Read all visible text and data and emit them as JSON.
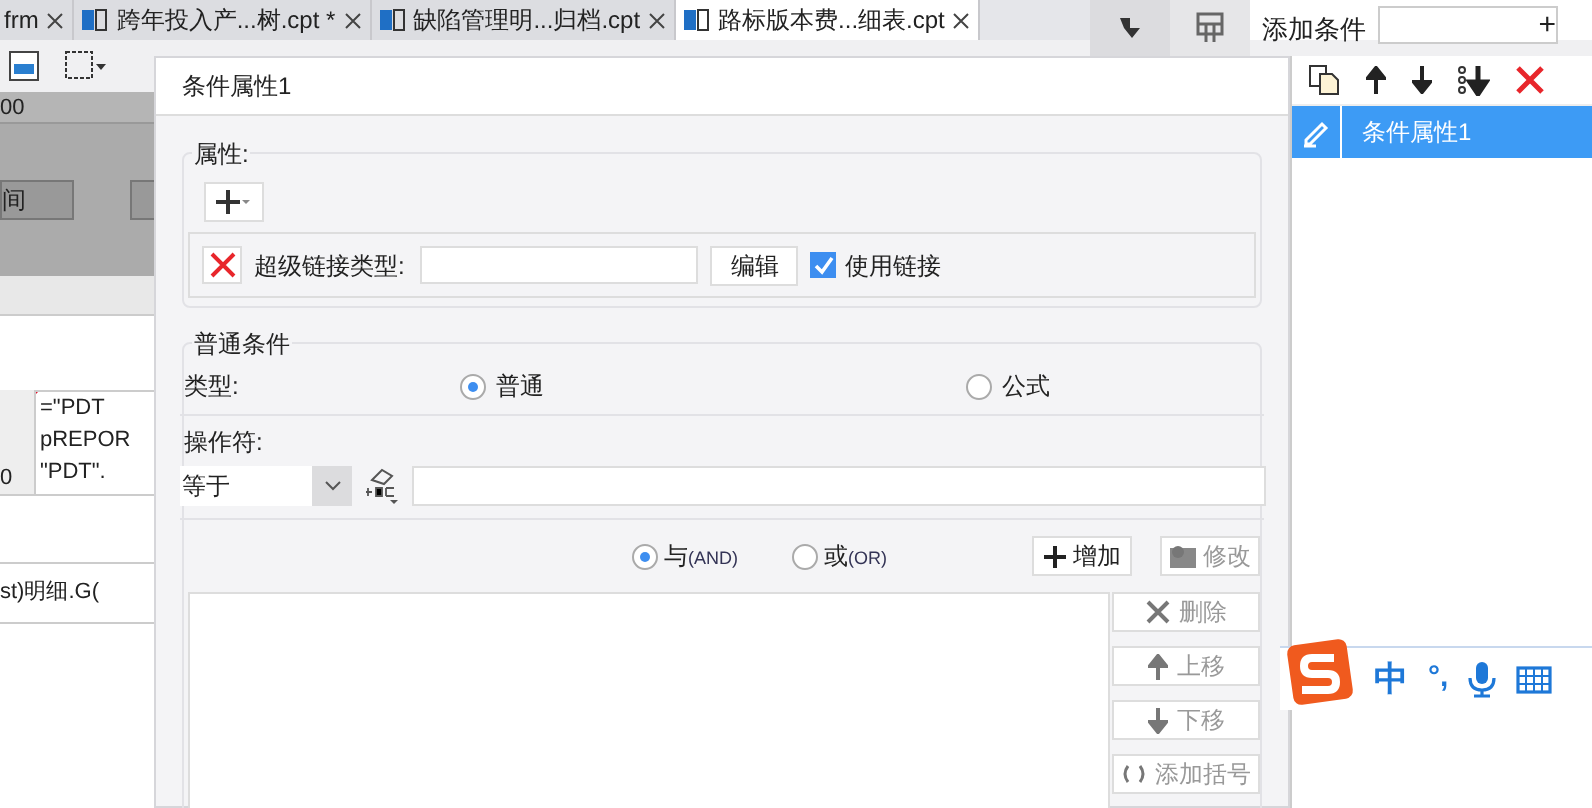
{
  "tabs": [
    {
      "label": "frm",
      "selected": false
    },
    {
      "label": "跨年投入产...树.cpt *",
      "selected": false
    },
    {
      "label": "缺陷管理明...归档.cpt",
      "selected": false
    },
    {
      "label": "路标版本费...细表.cpt",
      "selected": true
    }
  ],
  "sheet": {
    "ruler": "00",
    "button": "间",
    "formula_lines": [
      "=\"PDT",
      "pREPOR",
      "\"PDT\"."
    ],
    "left_cell": "0",
    "bottom_cell": "st)明细.G("
  },
  "dialog": {
    "title": "条件属性1",
    "attributes": {
      "legend": "属性:",
      "link_type_label": "超级链接类型:",
      "edit_button": "编辑",
      "use_link": {
        "label": "使用链接",
        "checked": true
      }
    },
    "condition": {
      "legend": "普通条件",
      "type_label": "类型:",
      "type_options": [
        {
          "label": "普通",
          "selected": true
        },
        {
          "label": "公式",
          "selected": false
        }
      ],
      "operator_label": "操作符:",
      "operator": "等于",
      "logic_options": [
        {
          "label": "与",
          "code": "(AND)",
          "selected": true
        },
        {
          "label": "或",
          "code": "(OR)",
          "selected": false
        }
      ],
      "add_button": {
        "label": "增加",
        "disabled": false
      },
      "modify_button": {
        "label": "修改",
        "disabled": true
      },
      "side_buttons": [
        {
          "kind": "delete",
          "label": "删除",
          "disabled": true
        },
        {
          "kind": "up",
          "label": "上移",
          "disabled": true
        },
        {
          "kind": "down",
          "label": "下移",
          "disabled": true
        },
        {
          "kind": "bracket",
          "label": "添加括号",
          "disabled": true
        }
      ]
    }
  },
  "panel": {
    "add_label": "添加条件",
    "add_button": "+",
    "items": [
      {
        "label": "条件属性1",
        "selected": true
      }
    ]
  },
  "ime": {
    "mode": "中",
    "punctuation": "°,"
  }
}
